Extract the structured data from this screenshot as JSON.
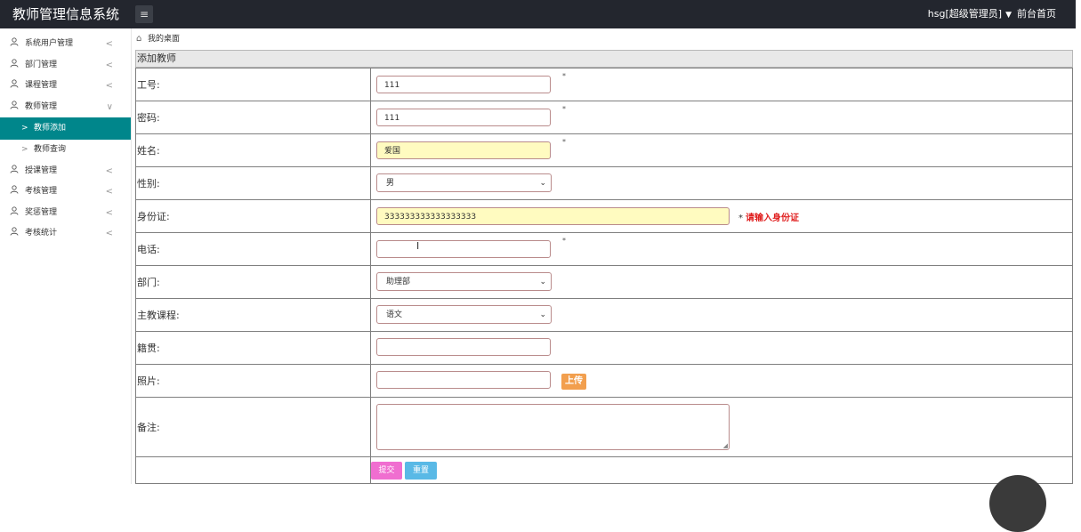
{
  "app": {
    "title": "教师管理信息系统",
    "menu_toggle": "≡",
    "user": "hsg[超级管理员]",
    "user_caret": "▼",
    "front_page": "前台首页"
  },
  "sidebar": {
    "items": [
      {
        "label": "系统用户管理",
        "chevron": "<"
      },
      {
        "label": "部门管理",
        "chevron": "<"
      },
      {
        "label": "课程管理",
        "chevron": "<"
      },
      {
        "label": "教师管理",
        "chevron": "∨"
      },
      {
        "label": "教师添加",
        "arrow": ">"
      },
      {
        "label": "教师查询",
        "arrow": ">"
      },
      {
        "label": "授课管理",
        "chevron": "<"
      },
      {
        "label": "考核管理",
        "chevron": "<"
      },
      {
        "label": "奖惩管理",
        "chevron": "<"
      },
      {
        "label": "考核统计",
        "chevron": "<"
      }
    ]
  },
  "breadcrumb": {
    "home_icon": "⌂",
    "label": "我的桌面"
  },
  "form": {
    "header": "添加教师",
    "required_mark": "*",
    "fields": {
      "job_no": {
        "label": "工号:",
        "value": "111"
      },
      "password": {
        "label": "密码:",
        "value": "111"
      },
      "name": {
        "label": "姓名:",
        "value": "爱国"
      },
      "gender": {
        "label": "性别:",
        "value": "男"
      },
      "id_card": {
        "label": "身份证:",
        "value": "333333333333333333",
        "error": "请输入身份证"
      },
      "phone": {
        "label": "电话:",
        "value": ""
      },
      "department": {
        "label": "部门:",
        "value": "助理部"
      },
      "course": {
        "label": "主教课程:",
        "value": "语文"
      },
      "native_place": {
        "label": "籍贯:",
        "value": ""
      },
      "photo": {
        "label": "照片:",
        "value": "",
        "upload": "上传"
      },
      "remark": {
        "label": "备注:",
        "value": ""
      }
    },
    "submit": "提交",
    "reset": "重置"
  },
  "icons": {
    "user": "user-icon",
    "dropdown": "⌄",
    "resize_grip": "◢",
    "text_cursor": "I"
  },
  "colors": {
    "topbar": "#23262e",
    "active_nav": "#00868b",
    "submit": "#f06ed0",
    "reset": "#59b9e6",
    "upload": "#f29f4e",
    "error": "#e02020",
    "autofill": "#fffbc0"
  }
}
